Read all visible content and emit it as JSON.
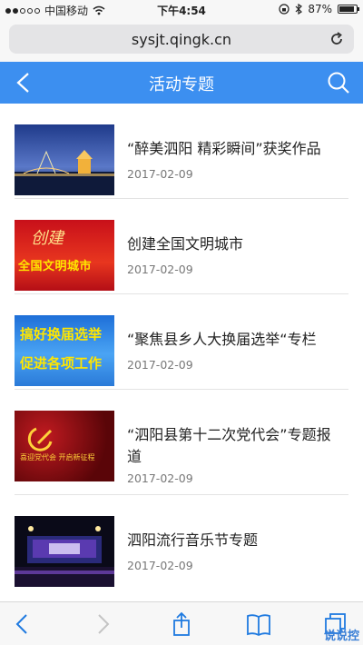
{
  "status_bar": {
    "carrier": "中国移动",
    "time": "下午4:54",
    "battery": "87%",
    "battery_level": 0.87
  },
  "browser": {
    "url": "sysjt.qingk.cn"
  },
  "header": {
    "title": "活动专题"
  },
  "items": [
    {
      "title": "“醉美泗阳 精彩瞬间”获奖作品",
      "date": "2017-02-09",
      "thumb_icon": "night-city-photo"
    },
    {
      "title": "创建全国文明城市",
      "date": "2017-02-09",
      "thumb_icon": "civilized-city-banner",
      "thumb_caption": "全国文明城市",
      "thumb_script": "创建"
    },
    {
      "title": "“聚焦县乡人大换届选举“专栏",
      "date": "2017-02-09",
      "thumb_icon": "election-banner",
      "thumb_lines": [
        "搞好换届选举",
        "促进各项工作"
      ]
    },
    {
      "title": "“泗阳县第十二次党代会”专题报道",
      "date": "2017-02-09",
      "thumb_icon": "party-congress-banner",
      "thumb_caption": "喜迎党代会 开启新征程"
    },
    {
      "title": "泗阳流行音乐节专题",
      "date": "2017-02-09",
      "thumb_icon": "concert-stage-photo"
    }
  ],
  "watermark": "说说控",
  "colors": {
    "header": "#3c8ff0",
    "toolbar_icon": "#1f7ae0",
    "date_text": "#777777"
  }
}
